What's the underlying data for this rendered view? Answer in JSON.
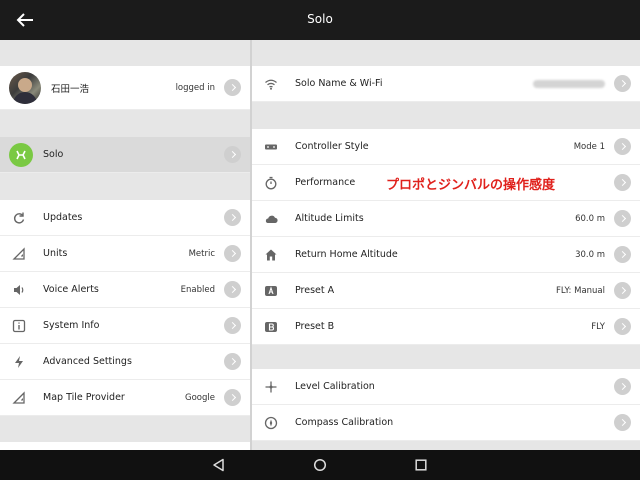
{
  "header": {
    "title": "Solo"
  },
  "account": {
    "name": "石田一浩",
    "status": "logged in"
  },
  "left_items": [
    {
      "label": "Solo"
    },
    {
      "label": "Updates",
      "value": ""
    },
    {
      "label": "Units",
      "value": "Metric"
    },
    {
      "label": "Voice Alerts",
      "value": "Enabled"
    },
    {
      "label": "System Info",
      "value": ""
    },
    {
      "label": "Advanced Settings",
      "value": ""
    },
    {
      "label": "Map Tile Provider",
      "value": "Google"
    }
  ],
  "right_items": [
    {
      "label": "Solo Name & Wi-Fi",
      "value": ""
    },
    {
      "label": "Controller Style",
      "value": "Mode 1"
    },
    {
      "label": "Performance",
      "value": ""
    },
    {
      "label": "Altitude Limits",
      "value": "60.0 m"
    },
    {
      "label": "Return Home Altitude",
      "value": "30.0 m"
    },
    {
      "label": "Preset A",
      "value": "FLY: Manual"
    },
    {
      "label": "Preset B",
      "value": "FLY"
    },
    {
      "label": "Level Calibration",
      "value": ""
    },
    {
      "label": "Compass Calibration",
      "value": ""
    }
  ],
  "annotation": "プロポとジンバルの操作感度",
  "colors": {
    "topbar": "#1b1b1b",
    "accent_green": "#7ac943",
    "annotation_red": "#e0211c"
  },
  "icons": {
    "back": "arrow-left-icon",
    "nav": [
      "nav-back-triangle-icon",
      "nav-home-circle-icon",
      "nav-recents-square-icon"
    ]
  }
}
